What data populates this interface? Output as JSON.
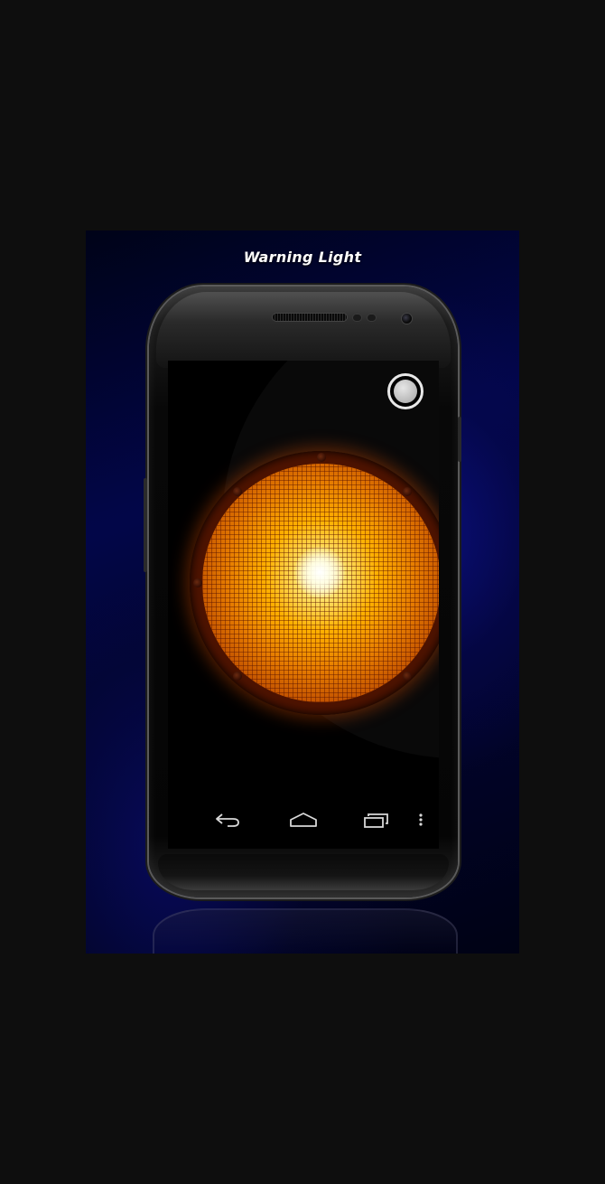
{
  "app": {
    "title": "Warning Light"
  },
  "light": {
    "state": "on",
    "color": "#ffb000"
  },
  "toggle": {
    "icon": "toggle-circle-icon"
  },
  "navbar": {
    "items": [
      {
        "name": "back",
        "icon": "back-arrow-icon"
      },
      {
        "name": "home",
        "icon": "home-icon"
      },
      {
        "name": "recents",
        "icon": "recent-apps-icon"
      },
      {
        "name": "menu",
        "icon": "overflow-menu-icon"
      }
    ]
  },
  "colors": {
    "background": "#02064a",
    "title": "#ffffff",
    "lamp": "#ffb000"
  }
}
